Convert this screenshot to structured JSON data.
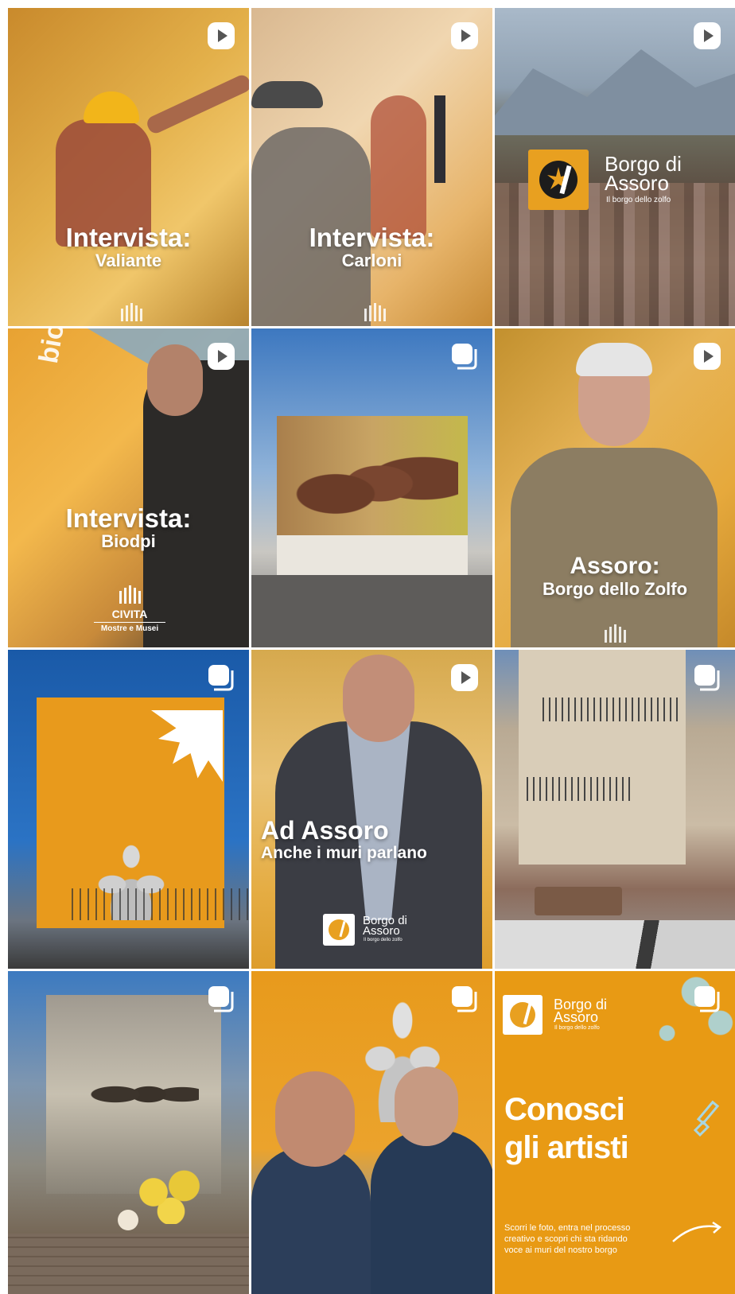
{
  "colors": {
    "brand_orange": "#e8a020",
    "sky_blue": "#1e6fc0",
    "white": "#ffffff"
  },
  "posts": [
    {
      "type": "reel",
      "icon": "reel-play-icon",
      "title": "Intervista:",
      "subtitle": "Valiante"
    },
    {
      "type": "reel",
      "icon": "reel-play-icon",
      "title": "Intervista:",
      "subtitle": "Carloni"
    },
    {
      "type": "reel",
      "icon": "reel-play-icon",
      "logo": {
        "line1": "Borgo di",
        "line2": "Assoro",
        "tagline": "Il borgo dello zolfo"
      }
    },
    {
      "type": "reel",
      "icon": "reel-play-icon",
      "title": "Intervista:",
      "subtitle": "Biodpi",
      "civita": {
        "name": "CIVITA",
        "tag": "Mostre e Musei"
      },
      "wall_text": "biodpi"
    },
    {
      "type": "carousel",
      "icon": "carousel-icon"
    },
    {
      "type": "reel",
      "icon": "reel-play-icon",
      "title": "Assoro:",
      "subtitle": "Borgo dello Zolfo"
    },
    {
      "type": "carousel",
      "icon": "carousel-icon"
    },
    {
      "type": "reel",
      "icon": "reel-play-icon",
      "title": "Ad Assoro",
      "subtitle": "Anche i muri parlano",
      "logo": {
        "line1": "Borgo di",
        "line2": "Assoro",
        "tagline": "Il borgo dello zolfo"
      }
    },
    {
      "type": "carousel",
      "icon": "carousel-icon"
    },
    {
      "type": "carousel",
      "icon": "carousel-icon"
    },
    {
      "type": "carousel",
      "icon": "carousel-icon"
    },
    {
      "type": "carousel",
      "icon": "carousel-icon",
      "title_line1": "Conosci",
      "title_line2": "gli artisti",
      "body": [
        "Scorri le foto, entra nel processo",
        "creativo e scopri chi sta ridando",
        "voce ai muri del nostro borgo"
      ],
      "logo": {
        "line1": "Borgo di",
        "line2": "Assoro",
        "tagline": "Il borgo dello zolfo"
      }
    }
  ]
}
